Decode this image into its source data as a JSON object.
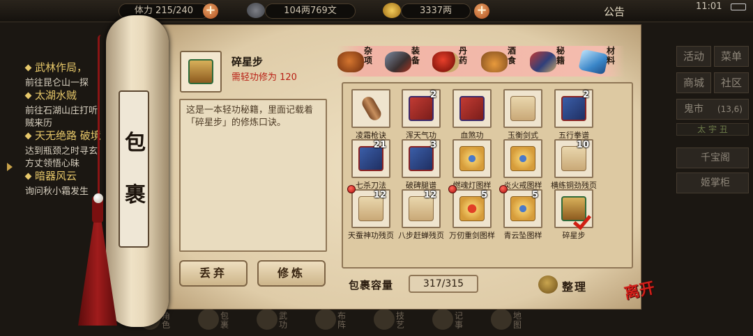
{
  "topbar": {
    "capacity_text": "体力 215/240",
    "copper_text": "104两769文",
    "silver_text": "3337两",
    "notice": "公告",
    "clock": "11:01"
  },
  "quests": [
    {
      "title": "武林作局，",
      "desc": "前往昆仑山一探"
    },
    {
      "title": "太湖水贼",
      "desc": "前往石湖山庄打听",
      "desc2": "贼来历"
    },
    {
      "title": "天无绝路 破境",
      "desc": "达到瓶颈之时寻玄",
      "desc2": "方丈领悟心昧"
    },
    {
      "title": "暗器风云",
      "desc": "询问秋小霜发生"
    }
  ],
  "right_menu": {
    "activity": "活动",
    "menu": "菜单",
    "shop": "商城",
    "community": "社区",
    "ghost_market": "鬼市",
    "ghost_market_time": "(13,6)",
    "day_bar": "太 宇 丑",
    "qianbaoge": "千宝阁",
    "jizhanggui": "姬掌柜"
  },
  "bottom_nav": [
    "角色",
    "包裹",
    "武功",
    "布阵",
    "技艺",
    "记事",
    "地图"
  ],
  "scroll": {
    "label_top": "包",
    "label_bottom": "裹"
  },
  "detail": {
    "name": "碎星步",
    "requirement": "需轻功修为 120",
    "description": "这是一本轻功秘籍，里面记载着「碎星步」的修炼口诀。",
    "drop_label": "丢弃",
    "train_label": "修炼"
  },
  "categories": [
    {
      "label": "杂项",
      "icon": "misc-pot-icon"
    },
    {
      "label": "装备",
      "icon": "equipment-icon"
    },
    {
      "label": "丹药",
      "icon": "pill-icon"
    },
    {
      "label": "酒食",
      "icon": "wine-food-icon"
    },
    {
      "label": "秘籍",
      "icon": "manual-book-icon",
      "active": true
    },
    {
      "label": "材料",
      "icon": "material-crystal-icon"
    }
  ],
  "items": [
    {
      "name": "凌霜枪诀",
      "count": "",
      "type": "scroll-roll",
      "dot": false
    },
    {
      "name": "浑天气功",
      "count": "2",
      "type": "book-red",
      "dot": false
    },
    {
      "name": "血煞功",
      "count": "",
      "type": "book-red",
      "dot": false
    },
    {
      "name": "玉衡剑式",
      "count": "",
      "type": "scroll-paper",
      "dot": false
    },
    {
      "name": "五行拳谱",
      "count": "2",
      "type": "book-blue",
      "dot": false
    },
    {
      "name": "七杀刀法",
      "count": "21",
      "type": "book-blue",
      "dot": false
    },
    {
      "name": "破碑腿谱",
      "count": "3",
      "type": "book-blue",
      "dot": false
    },
    {
      "name": "燃魂灯图样",
      "count": "",
      "type": "scroll-gold",
      "dot": false
    },
    {
      "name": "炎火戒图样",
      "count": "",
      "type": "scroll-gold",
      "dot": false
    },
    {
      "name": "横练铜劲残页",
      "count": "10",
      "type": "scroll-paper",
      "dot": false
    },
    {
      "name": "天蚕神功残页",
      "count": "12",
      "type": "scroll-paper",
      "dot": true
    },
    {
      "name": "八步赶蝉残页",
      "count": "12",
      "type": "scroll-paper",
      "dot": false
    },
    {
      "name": "万仞重剑图样",
      "count": "5",
      "type": "scroll-fire",
      "dot": true
    },
    {
      "name": "青云坠图样",
      "count": "5",
      "type": "scroll-gold",
      "dot": true
    },
    {
      "name": "碎星步",
      "count": "",
      "type": "sutra-gift",
      "dot": false,
      "selected": true
    }
  ],
  "footer": {
    "capacity_label": "包裹容量",
    "capacity_value": "317/315",
    "sort_label": "整理",
    "leave_label": "离开"
  },
  "colors": {
    "accent_red": "#b81f14",
    "paper": "#e6d6b6",
    "category_band": "#f4bcae"
  }
}
